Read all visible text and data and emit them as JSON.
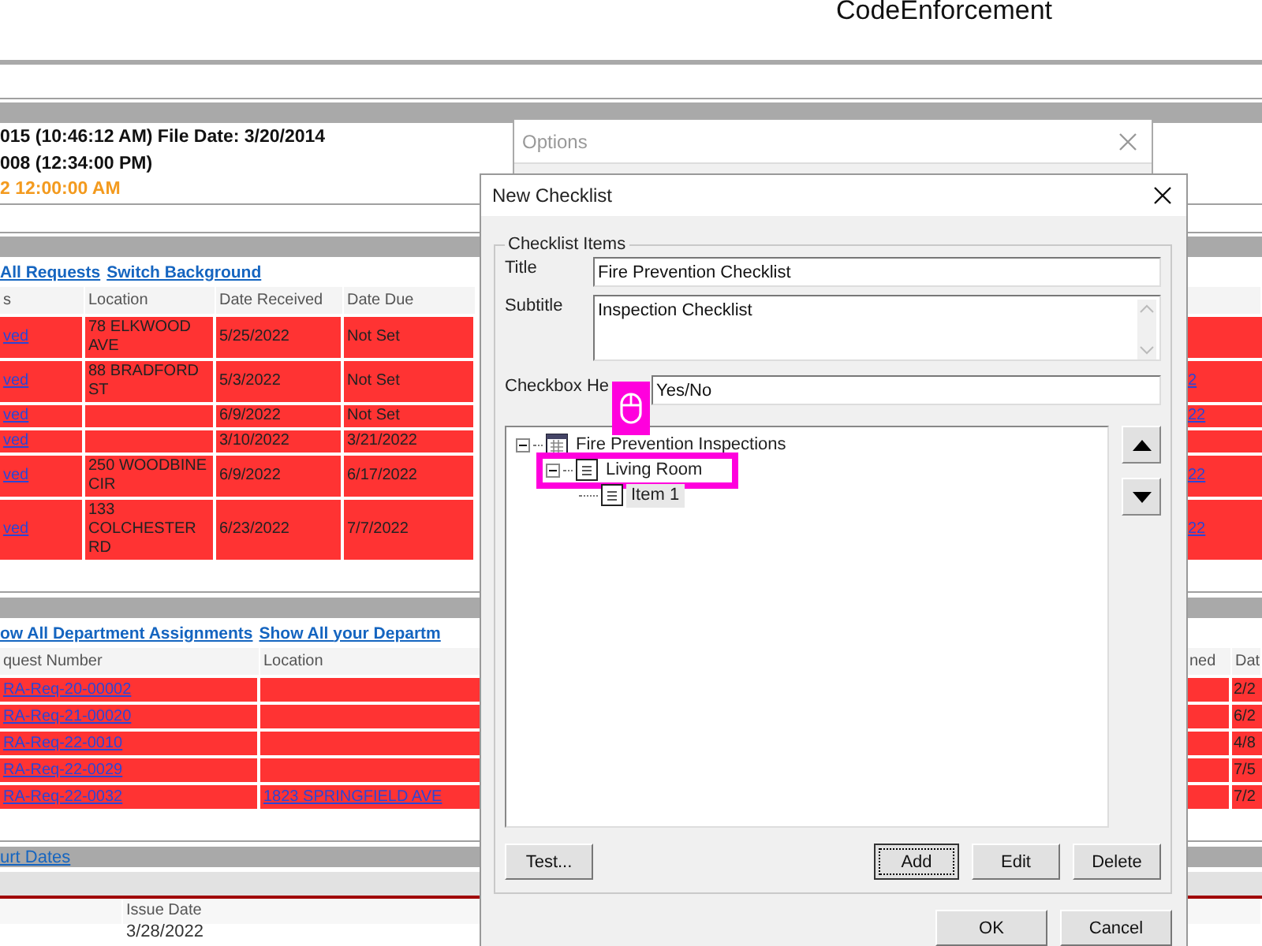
{
  "app": {
    "title": "CodeEnforcement"
  },
  "info_lines": [
    {
      "text": "015 (10:46:12 AM) File Date: 3/20/2014",
      "kind": "normal"
    },
    {
      "text": "008 (12:34:00 PM)",
      "kind": "normal"
    },
    {
      "text": "2 12:00:00 AM",
      "kind": "warning"
    }
  ],
  "requests": {
    "links": [
      "All Requests",
      "Switch Background"
    ],
    "columns": [
      "s",
      "Location",
      "Date Received",
      "Date Due"
    ],
    "rows": [
      {
        "status": "ved",
        "location": "78 ELKWOOD AVE",
        "received": "5/25/2022",
        "due": "Not Set"
      },
      {
        "status": "ved",
        "location": "88 BRADFORD ST",
        "received": "5/3/2022",
        "due": "Not Set",
        "column_5": "2"
      },
      {
        "status": "ved",
        "received": "6/9/2022",
        "due": "Not Set",
        "column_5": "22"
      },
      {
        "status": "ved",
        "received": "3/10/2022",
        "due": "3/21/2022"
      },
      {
        "status": "ved",
        "location": "250 WOODBINE CIR",
        "received": "6/9/2022",
        "due": "6/17/2022",
        "column_5": "22"
      },
      {
        "status": "ved",
        "location": "133 COLCHESTER RD",
        "received": "6/23/2022",
        "due": "7/7/2022",
        "column_5": "22"
      }
    ]
  },
  "assignments": {
    "links": [
      "ow All Department Assignments",
      "Show All your Departm"
    ],
    "columns": [
      "quest Number",
      "Location",
      "ned",
      "Dat"
    ],
    "rows": [
      {
        "number": "RA-Req-20-00002",
        "date": "2/2"
      },
      {
        "number": "RA-Req-21-00020",
        "date": "6/2"
      },
      {
        "number": "RA-Req-22-0010",
        "date": "4/8"
      },
      {
        "number": "RA-Req-22-0029",
        "date": "7/5"
      },
      {
        "number": "RA-Req-22-0032",
        "location": "1823 SPRINGFIELD AVE",
        "date": "7/2"
      }
    ]
  },
  "court_dates": {
    "link": "urt Dates",
    "columns": [
      "Issue Date"
    ],
    "rows": [
      "3/28/2022"
    ]
  },
  "options_window": {
    "title": "Options"
  },
  "dialog": {
    "title": "New Checklist",
    "group": "Checklist Items",
    "fields": [
      {
        "label": "Title",
        "value": "Fire Prevention Checklist",
        "kind": "line"
      },
      {
        "label": "Subtitle",
        "value": "Inspection Checklist",
        "kind": "multiline"
      },
      {
        "label": "Checkbox He",
        "value": "Yes/No",
        "kind": "line"
      }
    ],
    "tree": [
      {
        "label": "Fire Prevention Inspections",
        "kind": "checklist",
        "selected": false,
        "highlighted": false,
        "expanded": true,
        "children": [
          {
            "label": "Living Room",
            "kind": "section",
            "selected": false,
            "highlighted": true,
            "expanded": true,
            "children": [
              {
                "label": "Item 1",
                "kind": "item",
                "selected": true,
                "highlighted": false
              }
            ]
          }
        ]
      }
    ],
    "buttons": [
      {
        "label": "Test...",
        "default": false
      },
      {
        "label": "Add",
        "default": true
      },
      {
        "label": "Edit",
        "default": false
      },
      {
        "label": "Delete",
        "default": false
      }
    ],
    "footer_buttons": [
      "OK",
      "Cancel"
    ]
  }
}
